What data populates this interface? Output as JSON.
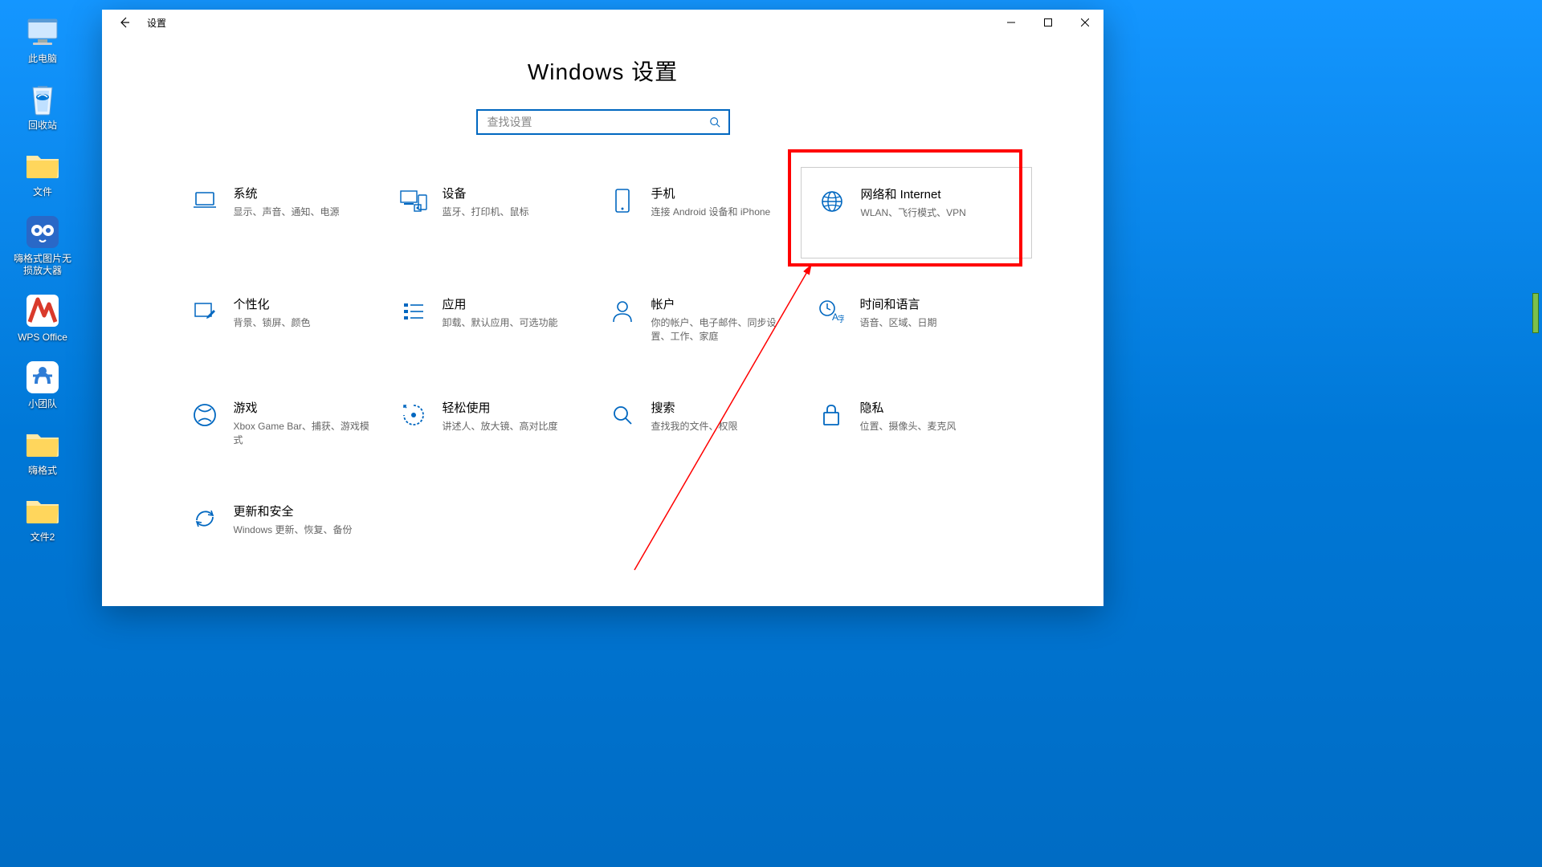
{
  "desktop_icons": [
    {
      "name": "此电脑",
      "icon": "pc"
    },
    {
      "name": "回收站",
      "icon": "bin"
    },
    {
      "name": "文件",
      "icon": "folder"
    },
    {
      "name": "嗨格式图片无损放大器",
      "icon": "app-owl"
    },
    {
      "name": "WPS Office",
      "icon": "wps"
    },
    {
      "name": "小团队",
      "icon": "team"
    },
    {
      "name": "嗨格式",
      "icon": "folder"
    },
    {
      "name": "文件2",
      "icon": "folder"
    }
  ],
  "window": {
    "app_title": "设置",
    "page_title": "Windows 设置",
    "search_placeholder": "查找设置"
  },
  "categories": [
    {
      "key": "system",
      "title": "系统",
      "desc": "显示、声音、通知、电源",
      "icon": "laptop"
    },
    {
      "key": "devices",
      "title": "设备",
      "desc": "蓝牙、打印机、鼠标",
      "icon": "devices"
    },
    {
      "key": "phone",
      "title": "手机",
      "desc": "连接 Android 设备和 iPhone",
      "icon": "phone"
    },
    {
      "key": "network",
      "title": "网络和 Internet",
      "desc": "WLAN、飞行模式、VPN",
      "icon": "globe",
      "highlighted": true
    },
    {
      "key": "personalization",
      "title": "个性化",
      "desc": "背景、锁屏、颜色",
      "icon": "pen"
    },
    {
      "key": "apps",
      "title": "应用",
      "desc": "卸载、默认应用、可选功能",
      "icon": "apps"
    },
    {
      "key": "accounts",
      "title": "帐户",
      "desc": "你的帐户、电子邮件、同步设置、工作、家庭",
      "icon": "person"
    },
    {
      "key": "time",
      "title": "时间和语言",
      "desc": "语音、区域、日期",
      "icon": "time-lang"
    },
    {
      "key": "gaming",
      "title": "游戏",
      "desc": "Xbox Game Bar、捕获、游戏模式",
      "icon": "xbox"
    },
    {
      "key": "ease",
      "title": "轻松使用",
      "desc": "讲述人、放大镜、高对比度",
      "icon": "ease"
    },
    {
      "key": "search",
      "title": "搜索",
      "desc": "查找我的文件、权限",
      "icon": "search"
    },
    {
      "key": "privacy",
      "title": "隐私",
      "desc": "位置、摄像头、麦克风",
      "icon": "lock"
    },
    {
      "key": "update",
      "title": "更新和安全",
      "desc": "Windows 更新、恢复、备份",
      "icon": "sync"
    }
  ],
  "colors": {
    "accent": "#0067c0",
    "highlight": "#ff0000"
  }
}
